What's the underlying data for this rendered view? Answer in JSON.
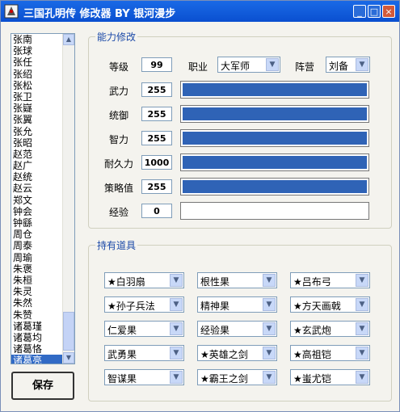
{
  "window": {
    "title": "三国孔明传 修改器 BY 银河漫步"
  },
  "titlebar_buttons": {
    "minimize": "_",
    "maximize": "□",
    "close": "×"
  },
  "character_list": {
    "items": [
      "张南",
      "张球",
      "张任",
      "张绍",
      "张松",
      "张卫",
      "张嶷",
      "张翼",
      "张允",
      "张昭",
      "赵范",
      "赵广",
      "赵统",
      "赵云",
      "郑文",
      "钟会",
      "钟繇",
      "周仓",
      "周泰",
      "周瑜",
      "朱褒",
      "朱桓",
      "朱灵",
      "朱然",
      "朱赞",
      "诸葛瑾",
      "诸葛均",
      "诸葛恪",
      "诸葛亮"
    ],
    "selected_index": 28
  },
  "save_button": {
    "label": "保存"
  },
  "ability_group": {
    "title": "能力修改",
    "level": {
      "label": "等级",
      "value": "99"
    },
    "job": {
      "label": "职业",
      "value": "大军师"
    },
    "faction": {
      "label": "阵营",
      "value": "刘备"
    },
    "stats": [
      {
        "label": "武力",
        "value": "255",
        "fill": 1.0
      },
      {
        "label": "统御",
        "value": "255",
        "fill": 1.0
      },
      {
        "label": "智力",
        "value": "255",
        "fill": 1.0
      },
      {
        "label": "耐久力",
        "value": "1000",
        "fill": 1.0
      },
      {
        "label": "策略值",
        "value": "255",
        "fill": 1.0
      },
      {
        "label": "经验",
        "value": "0",
        "fill": 0.0
      }
    ]
  },
  "items_group": {
    "title": "持有道具",
    "items": [
      "★白羽扇",
      "根性果",
      "★吕布弓",
      "★孙子兵法",
      "精神果",
      "★方天画戟",
      "仁爱果",
      "经验果",
      "★玄武炮",
      "武勇果",
      "★英雄之剑",
      "★高祖铠",
      "智谋果",
      "★霸王之剑",
      "★蚩尤铠"
    ]
  },
  "colors": {
    "titlebar": "#0a4fd0",
    "bar_fill": "#2f63b6",
    "selection": "#316ac5",
    "group_title": "#1c4aa8"
  }
}
